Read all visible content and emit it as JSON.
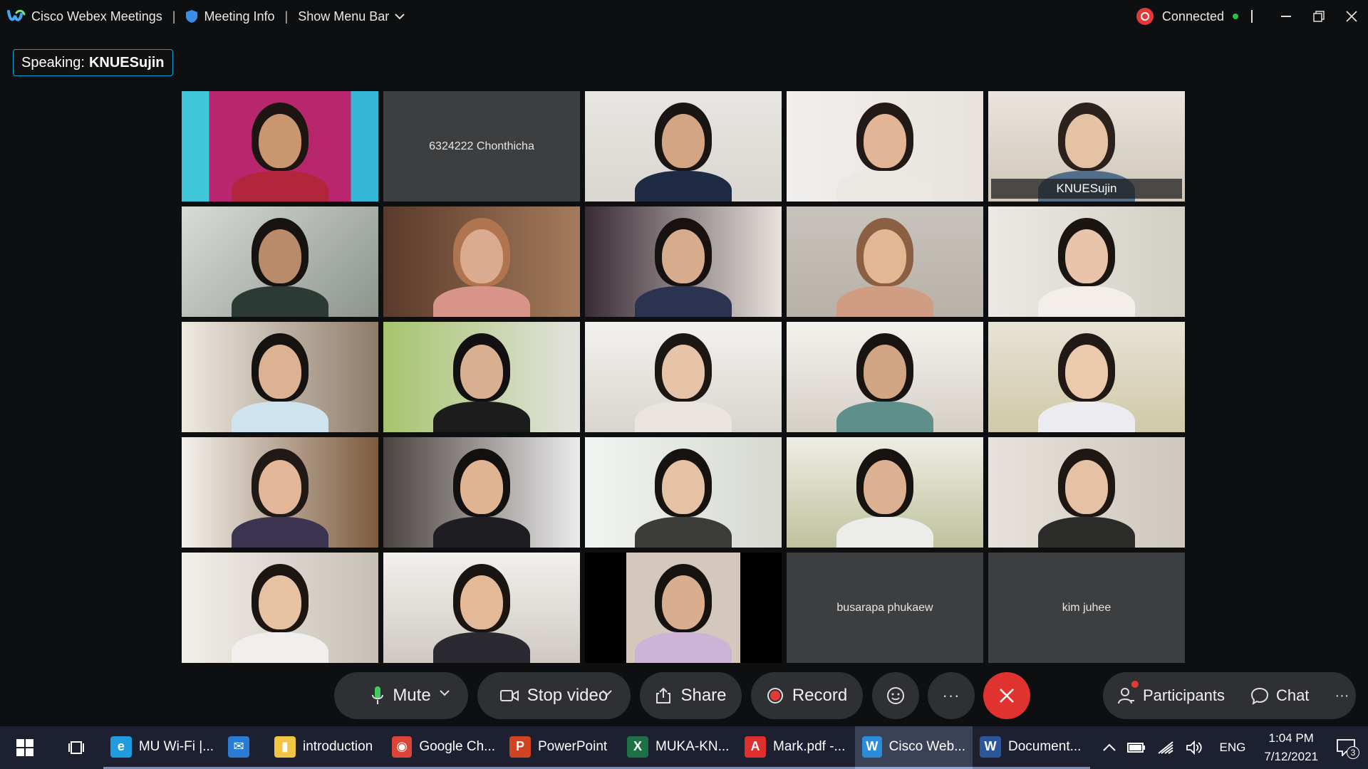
{
  "window": {
    "app_title": "Cisco Webex Meetings",
    "meeting_info": "Meeting Info",
    "show_menu_bar": "Show Menu Bar",
    "status": "Connected"
  },
  "speaking": {
    "prefix": "Speaking:",
    "name": "KNUESujin"
  },
  "participants": [
    {
      "label": "",
      "video": true
    },
    {
      "label": "6324222 Chonthicha",
      "video": false
    },
    {
      "label": "",
      "video": true
    },
    {
      "label": "",
      "video": true
    },
    {
      "label": "KNUESujin",
      "video": true,
      "active": true
    },
    {
      "label": "",
      "video": true
    },
    {
      "label": "",
      "video": true
    },
    {
      "label": "",
      "video": true
    },
    {
      "label": "",
      "video": true
    },
    {
      "label": "",
      "video": true
    },
    {
      "label": "",
      "video": true
    },
    {
      "label": "",
      "video": true
    },
    {
      "label": "",
      "video": true
    },
    {
      "label": "",
      "video": true
    },
    {
      "label": "",
      "video": true
    },
    {
      "label": "",
      "video": true
    },
    {
      "label": "",
      "video": true
    },
    {
      "label": "",
      "video": true
    },
    {
      "label": "",
      "video": true
    },
    {
      "label": "",
      "video": true
    },
    {
      "label": "",
      "video": true
    },
    {
      "label": "",
      "video": true
    },
    {
      "label": "",
      "video": true
    },
    {
      "label": "busarapa phukaew",
      "video": false
    },
    {
      "label": "kim juhee",
      "video": false
    }
  ],
  "controls": {
    "mute": "Mute",
    "stop_video": "Stop video",
    "share": "Share",
    "record": "Record",
    "participants": "Participants",
    "chat": "Chat",
    "more": "···"
  },
  "taskbar": {
    "items": [
      {
        "label": "MU Wi-Fi |...",
        "icon": "edge-icon",
        "color": "#1f9bde"
      },
      {
        "label": "",
        "icon": "mail-icon",
        "color": "#2a7bd4"
      },
      {
        "label": "introduction",
        "icon": "folder-icon",
        "color": "#f4c542"
      },
      {
        "label": "Google Ch...",
        "icon": "chrome-icon",
        "color": "#db4437"
      },
      {
        "label": "PowerPoint",
        "icon": "powerpoint-icon",
        "color": "#d04423"
      },
      {
        "label": "MUKA-KN...",
        "icon": "excel-icon",
        "color": "#1e7145"
      },
      {
        "label": "Mark.pdf -...",
        "icon": "pdf-icon",
        "color": "#e02f2f"
      },
      {
        "label": "Cisco Web...",
        "icon": "webex-icon",
        "color": "#2e8bd8"
      },
      {
        "label": "Document...",
        "icon": "word-icon",
        "color": "#2b579a"
      }
    ],
    "lang": "ENG",
    "time": "1:04 PM",
    "date": "7/12/2021",
    "notifications": "3"
  }
}
